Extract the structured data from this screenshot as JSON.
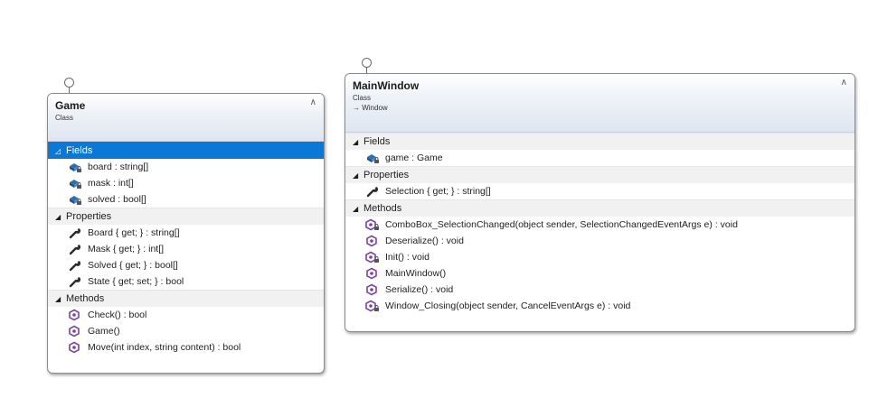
{
  "classes": [
    {
      "name": "Game",
      "kind": "Class",
      "base": "",
      "collapse_glyph": "∧",
      "sections": [
        {
          "title": "Fields",
          "glyph": "◿",
          "selected": true,
          "members": [
            {
              "text": "board : string[]",
              "icon": "private-field-icon"
            },
            {
              "text": "mask : int[]",
              "icon": "private-field-icon"
            },
            {
              "text": "solved : bool[]",
              "icon": "private-field-icon"
            }
          ]
        },
        {
          "title": "Properties",
          "glyph": "◢",
          "selected": false,
          "members": [
            {
              "text": "Board { get; } : string[]",
              "icon": "property-wrench-icon"
            },
            {
              "text": "Mask { get; } : int[]",
              "icon": "property-wrench-icon"
            },
            {
              "text": "Solved { get; } : bool[]",
              "icon": "property-wrench-icon"
            },
            {
              "text": "State { get; set; } : bool",
              "icon": "property-wrench-icon"
            }
          ]
        },
        {
          "title": "Methods",
          "glyph": "◢",
          "selected": false,
          "members": [
            {
              "text": "Check() : bool",
              "icon": "public-method-icon"
            },
            {
              "text": "Game()",
              "icon": "public-method-icon"
            },
            {
              "text": "Move(int index, string content) : bool",
              "icon": "public-method-icon"
            }
          ]
        }
      ]
    },
    {
      "name": "MainWindow",
      "kind": "Class",
      "base": "→ Window",
      "collapse_glyph": "∧",
      "sections": [
        {
          "title": "Fields",
          "glyph": "◢",
          "selected": false,
          "members": [
            {
              "text": "game : Game",
              "icon": "private-field-icon"
            }
          ]
        },
        {
          "title": "Properties",
          "glyph": "◢",
          "selected": false,
          "members": [
            {
              "text": "Selection { get; } : string[]",
              "icon": "property-wrench-icon"
            }
          ]
        },
        {
          "title": "Methods",
          "glyph": "◢",
          "selected": false,
          "members": [
            {
              "text": "ComboBox_SelectionChanged(object sender, SelectionChangedEventArgs e) : void",
              "icon": "private-method-icon"
            },
            {
              "text": "Deserialize() : void",
              "icon": "public-method-icon"
            },
            {
              "text": "Init() : void",
              "icon": "private-method-icon"
            },
            {
              "text": "MainWindow()",
              "icon": "public-method-icon"
            },
            {
              "text": "Serialize() : void",
              "icon": "public-method-icon"
            },
            {
              "text": "Window_Closing(object sender, CancelEventArgs e) : void",
              "icon": "private-method-icon"
            }
          ]
        }
      ]
    }
  ],
  "colors": {
    "selection": "#0a78d7",
    "field_icon": "#2d6fb5",
    "method_icon": "#7b3fa8",
    "wrench_icon": "#2b2b2b"
  }
}
